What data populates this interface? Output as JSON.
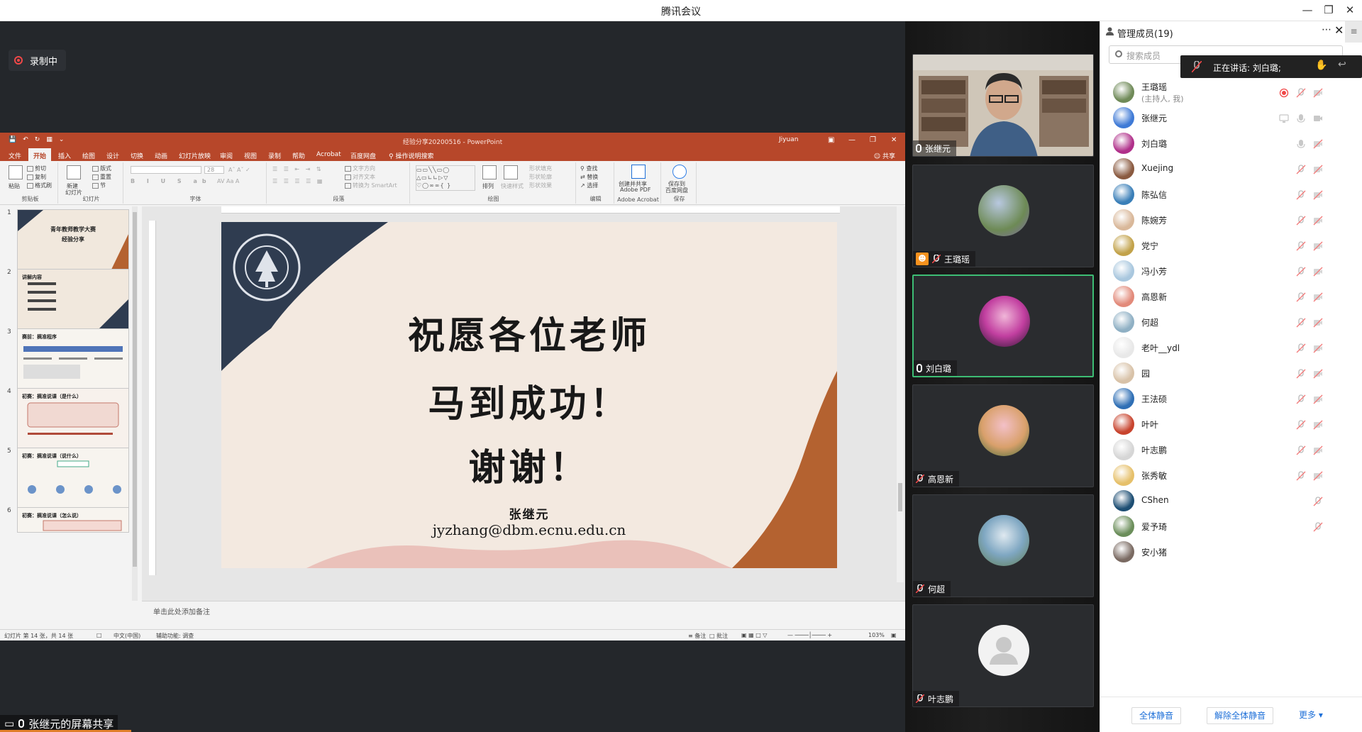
{
  "window": {
    "title": "腾讯会议"
  },
  "recording": {
    "label": "录制中"
  },
  "screen_share": {
    "label": "张继元的屏幕共享"
  },
  "ppt": {
    "doc_title": "经验分享20200516  -  PowerPoint",
    "account": "Jiyuan",
    "tabs": [
      "文件",
      "开始",
      "插入",
      "绘图",
      "设计",
      "切换",
      "动画",
      "幻灯片放映",
      "审阅",
      "视图",
      "录制",
      "帮助",
      "Acrobat",
      "百度网盘"
    ],
    "active_tab": "开始",
    "search_hint": "操作说明搜索",
    "share": "共享",
    "ribbon": {
      "clipboard": {
        "paste": "粘贴",
        "cut": "剪切",
        "copy": "复制",
        "format": "格式刷",
        "name": "剪贴板"
      },
      "slides": {
        "new": "新建",
        "new2": "幻灯片",
        "layout": "版式",
        "reset": "重置",
        "section": "节",
        "name": "幻灯片"
      },
      "font": {
        "size": "28",
        "name": "字体"
      },
      "paragraph": {
        "dir": "文字方向",
        "align": "对齐文本",
        "smartart": "转换为 SmartArt",
        "name": "段落"
      },
      "drawing": {
        "arrange": "排列",
        "styles": "快速样式",
        "fill": "形状填充",
        "outline": "形状轮廓",
        "effect": "形状效果",
        "name": "绘图"
      },
      "editing": {
        "find": "查找",
        "replace": "替换",
        "select": "选择",
        "name": "编辑"
      },
      "acrobat": {
        "btn1": "创建并共享",
        "btn2": "Adobe PDF",
        "name": "Adobe Acrobat"
      },
      "save": {
        "btn1": "保存到",
        "btn2": "百度网盘",
        "name": "保存"
      }
    },
    "thumbnails": [
      {
        "num": "1",
        "title": "青年教师教学大赛",
        "subtitle": "经验分享"
      },
      {
        "num": "2",
        "title": "讲解内容"
      },
      {
        "num": "3",
        "title": "赛前：摘准程序"
      },
      {
        "num": "4",
        "title": "初赛：摘准说课（是什么）"
      },
      {
        "num": "5",
        "title": "初赛：摘准说课（说什么）"
      },
      {
        "num": "6",
        "title": "初赛：摘准说课（怎么说）"
      }
    ],
    "slide": {
      "line1": "祝愿各位老师",
      "line2": "马到成功！",
      "line3": "谢谢！",
      "name": "张继元",
      "email": "jyzhang@dbm.ecnu.edu.cn"
    },
    "notes_placeholder": "单击此处添加备注",
    "status": {
      "slide_count": "幻灯片 第 14 张，共 14 张",
      "language": "中文(中国)",
      "accessibility": "辅助功能: 调查",
      "notes": "备注",
      "comments": "批注",
      "zoom": "103%"
    }
  },
  "video_tiles": [
    {
      "name": "张继元",
      "type": "camera",
      "mic": "on"
    },
    {
      "name": "王璐瑶",
      "type": "avatar",
      "mic": "off",
      "host": true,
      "avatar_color": "#7f6aa8"
    },
    {
      "name": "刘白璐",
      "type": "avatar",
      "mic": "on",
      "speaking": true,
      "avatar_color": "#c23fa0"
    },
    {
      "name": "高恩新",
      "type": "avatar",
      "mic": "off",
      "avatar_color": "#d9a06b"
    },
    {
      "name": "何超",
      "type": "avatar",
      "mic": "off",
      "avatar_color": "#7fa7c2"
    },
    {
      "name": "叶志鹏",
      "type": "avatar",
      "mic": "off",
      "avatar_color": "#f0f0f0"
    }
  ],
  "panel": {
    "title": "管理成员(19)",
    "search_placeholder": "搜索成员",
    "speaking_now": "正在讲话: 刘白璐;",
    "members": [
      {
        "name": "王璐瑶",
        "sub": "(主持人, 我)",
        "avatar_color": "#6f8a58",
        "recording": true,
        "mic": "off",
        "cam": "off"
      },
      {
        "name": "张继元",
        "avatar_color": "#3f7ad6",
        "mic": "on",
        "cam": "on",
        "sharing": true
      },
      {
        "name": "刘白璐",
        "avatar_color": "#b0308a",
        "mic": "on",
        "cam": "off"
      },
      {
        "name": "Xuejing",
        "avatar_color": "#8a5a40",
        "mic": "off",
        "cam": "off"
      },
      {
        "name": "陈弘信",
        "avatar_color": "#3a7fb8",
        "mic": "off",
        "cam": "off"
      },
      {
        "name": "陈婉芳",
        "avatar_color": "#d9b89a",
        "mic": "off",
        "cam": "off"
      },
      {
        "name": "党宁",
        "avatar_color": "#c2a24a",
        "mic": "off",
        "cam": "off"
      },
      {
        "name": "冯小芳",
        "avatar_color": "#a9c7de",
        "mic": "off",
        "cam": "off"
      },
      {
        "name": "高恩新",
        "avatar_color": "#e28a7a",
        "mic": "off",
        "cam": "off"
      },
      {
        "name": "何超",
        "avatar_color": "#8fb0c4",
        "mic": "off",
        "cam": "off"
      },
      {
        "name": "老叶__ydl",
        "avatar_color": "#e8e8e8",
        "mic": "off",
        "cam": "off"
      },
      {
        "name": "园",
        "avatar_color": "#d8c2a8",
        "mic": "off",
        "cam": "off"
      },
      {
        "name": "王法硕",
        "avatar_color": "#2f6fb5",
        "mic": "off",
        "cam": "off"
      },
      {
        "name": "叶叶",
        "avatar_color": "#c8442e",
        "mic": "off",
        "cam": "off"
      },
      {
        "name": "叶志鹏",
        "avatar_color": "#d6d6d6",
        "mic": "off",
        "cam": "off"
      },
      {
        "name": "张秀敏",
        "avatar_color": "#e6c06a",
        "mic": "off",
        "cam": "off"
      },
      {
        "name": "CShen",
        "avatar_color": "#1d4e73",
        "mic": "off"
      },
      {
        "name": "爱予琦",
        "avatar_color": "#6b8e5a",
        "mic": "off"
      },
      {
        "name": "安小猪",
        "avatar_color": "#7a6a62"
      }
    ],
    "buttons": {
      "mute_all": "全体静音",
      "unmute_all": "解除全体静音",
      "more": "更多"
    }
  },
  "colors": {
    "ppt_accent": "#b7472a",
    "slide_navy": "#2f3c50",
    "slide_rust": "#b46230",
    "speaking_green": "#3dbd74",
    "link_blue": "#1d6fd8"
  }
}
